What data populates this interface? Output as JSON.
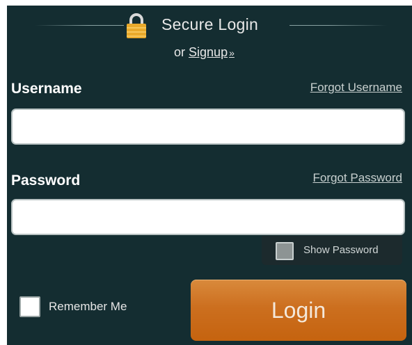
{
  "header": {
    "title": "Secure Login",
    "signup_prefix": "or",
    "signup_link": "Signup",
    "signup_chevron": "»"
  },
  "username": {
    "label": "Username",
    "forgot_link": "Forgot Username",
    "value": ""
  },
  "password": {
    "label": "Password",
    "forgot_link": "Forgot Password",
    "value": ""
  },
  "show_password": {
    "label": "Show Password",
    "checked": false
  },
  "remember_me": {
    "label": "Remember Me",
    "checked": false
  },
  "login_button": {
    "label": "Login"
  },
  "icons": {
    "lock": "lock-icon"
  },
  "colors": {
    "background": "#142d31",
    "accent": "#cc6f1f",
    "lock_gold": "#e9a92b"
  }
}
